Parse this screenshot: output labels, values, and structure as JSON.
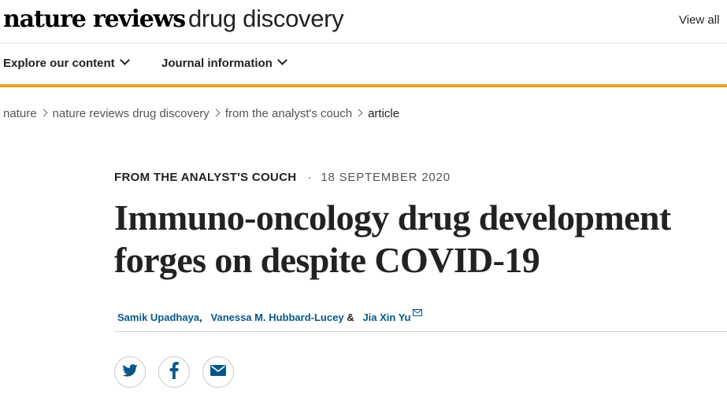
{
  "header": {
    "logo_brand": "nature reviews",
    "logo_journal": "drug discovery",
    "view_all": "View all"
  },
  "nav": {
    "items": [
      {
        "label": "Explore our content"
      },
      {
        "label": "Journal information"
      }
    ]
  },
  "breadcrumb": [
    "nature",
    "nature reviews drug discovery",
    "from the analyst's couch",
    "article"
  ],
  "article": {
    "type": "FROM THE ANALYST'S COUCH",
    "separator": "·",
    "date": "18 SEPTEMBER 2020",
    "title_line1": "Immuno-oncology drug development",
    "title_line2": "forges on despite COVID-19",
    "authors": [
      {
        "name": "Samik Upadhaya",
        "suffix": ","
      },
      {
        "name": "Vanessa M. Hubbard-Lucey",
        "suffix": "&"
      },
      {
        "name": "Jia Xin Yu",
        "suffix": ""
      }
    ]
  },
  "share": {
    "icons": [
      "twitter-icon",
      "facebook-icon",
      "email-icon"
    ],
    "icon_color": "#06588a"
  },
  "colors": {
    "accent": "#e8a225",
    "link": "#06588a",
    "text": "#222222"
  }
}
